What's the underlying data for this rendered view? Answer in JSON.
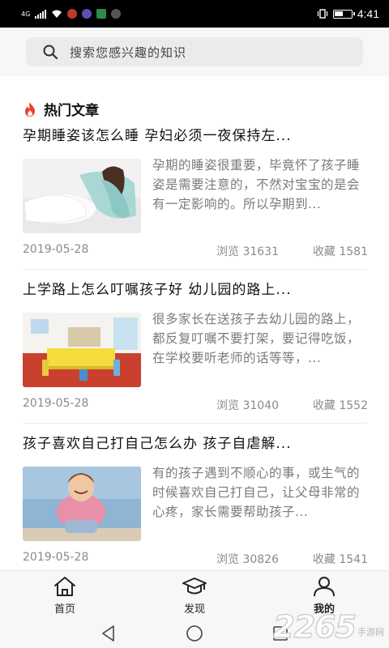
{
  "status_bar": {
    "network": "4G",
    "time": "4:41"
  },
  "search": {
    "placeholder": "搜索您感兴趣的知识"
  },
  "section": {
    "title": "热门文章"
  },
  "articles": [
    {
      "title": "孕期睡姿该怎么睡 孕妇必须一夜保持左...",
      "excerpt": "孕期的睡姿很重要，毕竟怀了孩子睡姿是需要注意的，不然对宝宝的是会有一定影响的。所以孕期到...",
      "date": "2019-05-28",
      "views": "浏览 31631",
      "favorites": "收藏 1581"
    },
    {
      "title": "上学路上怎么叮嘱孩子好 幼儿园的路上...",
      "excerpt": "很多家长在送孩子去幼儿园的路上，都反复叮嘱不要打架，要记得吃饭，在学校要听老师的话等等，...",
      "date": "2019-05-28",
      "views": "浏览 31040",
      "favorites": "收藏 1552"
    },
    {
      "title": "孩子喜欢自己打自己怎么办 孩子自虐解...",
      "excerpt": "有的孩子遇到不顺心的事，或生气的时候喜欢自己打自己，让父母非常的心疼，家长需要帮助孩子...",
      "date": "2019-05-28",
      "views": "浏览 30826",
      "favorites": "收藏 1541"
    }
  ],
  "bottom_nav": {
    "items": [
      {
        "label": "首页",
        "icon": "home-icon"
      },
      {
        "label": "发现",
        "icon": "graduation-cap-icon"
      },
      {
        "label": "我的",
        "icon": "user-icon"
      }
    ],
    "active": "我的"
  },
  "watermark": {
    "number": "2265",
    "suffix": "手游网"
  },
  "colors": {
    "fire_accent": "#e8432e",
    "status_bar_bg": "#000000",
    "search_bg": "#ebebeb"
  }
}
